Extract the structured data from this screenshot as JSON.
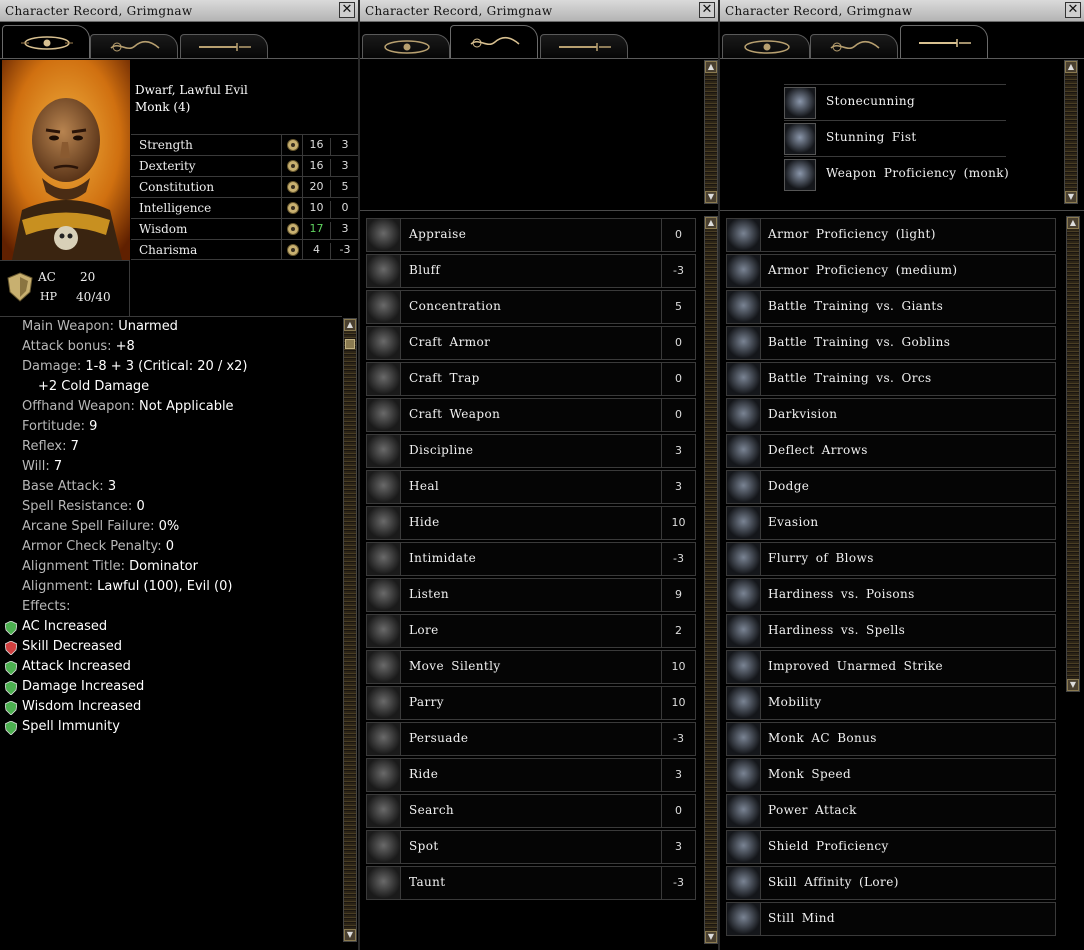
{
  "windows": {
    "title": "Character Record, Grimgnaw",
    "close_glyph": "✕",
    "tabs": [
      {
        "icon": "eye-icon",
        "label": "Character"
      },
      {
        "icon": "rope-icon",
        "label": "Skills"
      },
      {
        "icon": "dagger-icon",
        "label": "Feats"
      }
    ]
  },
  "character": {
    "race_alignment": "Dwarf, Lawful Evil",
    "class_level": "Monk (4)",
    "abilities": [
      {
        "name": "Strength",
        "icon": "strength-icon",
        "score": "16",
        "mod": "3",
        "highlight": false
      },
      {
        "name": "Dexterity",
        "icon": "dexterity-icon",
        "score": "16",
        "mod": "3",
        "highlight": false
      },
      {
        "name": "Constitution",
        "icon": "constitution-icon",
        "score": "20",
        "mod": "5",
        "highlight": false
      },
      {
        "name": "Intelligence",
        "icon": "intelligence-icon",
        "score": "10",
        "mod": "0",
        "highlight": false
      },
      {
        "name": "Wisdom",
        "icon": "wisdom-icon",
        "score": "17",
        "mod": "3",
        "highlight": true
      },
      {
        "name": "Charisma",
        "icon": "charisma-icon",
        "score": "4",
        "mod": "-3",
        "highlight": false
      }
    ],
    "ac_label": "AC",
    "ac_value": "20",
    "hp_label": "HP",
    "hp_value": "40/40",
    "combat": [
      {
        "k": "Main Weapon: ",
        "v": "Unarmed"
      },
      {
        "k": "Attack bonus: ",
        "v": "+8"
      },
      {
        "k": "Damage: ",
        "v": "1-8 + 3 (Critical: 20 / x2)"
      },
      {
        "k": "",
        "v": "+2 Cold Damage",
        "indent": true
      },
      {
        "k": "Offhand Weapon: ",
        "v": "Not Applicable"
      },
      {
        "k": "Fortitude: ",
        "v": "9"
      },
      {
        "k": "Reflex: ",
        "v": "7"
      },
      {
        "k": "Will: ",
        "v": "7"
      },
      {
        "k": "Base Attack: ",
        "v": "3"
      },
      {
        "k": "Spell Resistance: ",
        "v": "0"
      },
      {
        "k": "Arcane Spell Failure: ",
        "v": "0%"
      },
      {
        "k": "Armor Check Penalty: ",
        "v": "0"
      },
      {
        "k": "Alignment Title: ",
        "v": "Dominator"
      },
      {
        "k": "Alignment: ",
        "v": "Lawful (100), Evil (0)"
      },
      {
        "k": "Effects:",
        "v": ""
      }
    ],
    "effects": [
      {
        "name": "AC Increased",
        "color": "#4caf50"
      },
      {
        "name": "Skill Decreased",
        "color": "#d04040"
      },
      {
        "name": "Attack Increased",
        "color": "#4caf50"
      },
      {
        "name": "Damage Increased",
        "color": "#4caf50"
      },
      {
        "name": "Wisdom Increased",
        "color": "#4caf50"
      },
      {
        "name": "Spell Immunity",
        "color": "#4caf50"
      }
    ]
  },
  "skills": [
    {
      "name": "Appraise",
      "value": "0",
      "icon": "magnifier-icon"
    },
    {
      "name": "Bluff",
      "value": "-3",
      "icon": "mask-icon"
    },
    {
      "name": "Concentration",
      "value": "5",
      "icon": "meditating-face-icon"
    },
    {
      "name": "Craft Armor",
      "value": "0",
      "icon": "armor-icon"
    },
    {
      "name": "Craft Trap",
      "value": "0",
      "icon": "trap-icon"
    },
    {
      "name": "Craft Weapon",
      "value": "0",
      "icon": "sword-icon"
    },
    {
      "name": "Discipline",
      "value": "3",
      "icon": "armored-figure-icon"
    },
    {
      "name": "Heal",
      "value": "3",
      "icon": "healing-cross-icon"
    },
    {
      "name": "Hide",
      "value": "10",
      "icon": "hiding-figure-icon"
    },
    {
      "name": "Intimidate",
      "value": "-3",
      "icon": "angry-face-icon"
    },
    {
      "name": "Listen",
      "value": "9",
      "icon": "ear-icon"
    },
    {
      "name": "Lore",
      "value": "2",
      "icon": "book-icon"
    },
    {
      "name": "Move Silently",
      "value": "10",
      "icon": "sneaking-figure-icon"
    },
    {
      "name": "Parry",
      "value": "10",
      "icon": "crossed-swords-icon"
    },
    {
      "name": "Persuade",
      "value": "-3",
      "icon": "speaking-face-icon"
    },
    {
      "name": "Ride",
      "value": "3",
      "icon": "horse-icon"
    },
    {
      "name": "Search",
      "value": "0",
      "icon": "search-lens-icon"
    },
    {
      "name": "Spot",
      "value": "3",
      "icon": "eye-icon"
    },
    {
      "name": "Taunt",
      "value": "-3",
      "icon": "taunting-figure-icon"
    }
  ],
  "special_abilities": [
    {
      "name": "Stonecunning",
      "icon": "stone-hand-icon"
    },
    {
      "name": "Stunning Fist",
      "icon": "stunning-fist-icon"
    },
    {
      "name": "Weapon Proficiency (monk)",
      "icon": "monk-weapon-icon"
    }
  ],
  "feats": [
    {
      "name": "Armor Proficiency (light)",
      "icon": "light-armor-icon"
    },
    {
      "name": "Armor Proficiency (medium)",
      "icon": "medium-armor-icon"
    },
    {
      "name": "Battle Training vs. Giants",
      "icon": "battle-training-icon"
    },
    {
      "name": "Battle Training vs. Goblins",
      "icon": "battle-training-icon"
    },
    {
      "name": "Battle Training vs. Orcs",
      "icon": "battle-training-icon"
    },
    {
      "name": "Darkvision",
      "icon": "darkvision-eye-icon"
    },
    {
      "name": "Deflect Arrows",
      "icon": "deflect-arrows-icon"
    },
    {
      "name": "Dodge",
      "icon": "dodge-icon"
    },
    {
      "name": "Evasion",
      "icon": "evasion-icon"
    },
    {
      "name": "Flurry of Blows",
      "icon": "flurry-icon"
    },
    {
      "name": "Hardiness vs. Poisons",
      "icon": "poison-shield-icon"
    },
    {
      "name": "Hardiness vs. Spells",
      "icon": "spell-shield-icon"
    },
    {
      "name": "Improved Unarmed Strike",
      "icon": "unarmed-strike-icon"
    },
    {
      "name": "Mobility",
      "icon": "mobility-icon"
    },
    {
      "name": "Monk AC Bonus",
      "icon": "monk-ac-icon"
    },
    {
      "name": "Monk Speed",
      "icon": "monk-speed-icon"
    },
    {
      "name": "Power Attack",
      "icon": "power-attack-icon"
    },
    {
      "name": "Shield Proficiency",
      "icon": "shield-icon"
    },
    {
      "name": "Skill Affinity (Lore)",
      "icon": "skill-affinity-icon"
    },
    {
      "name": "Still Mind",
      "icon": "still-mind-icon"
    }
  ]
}
